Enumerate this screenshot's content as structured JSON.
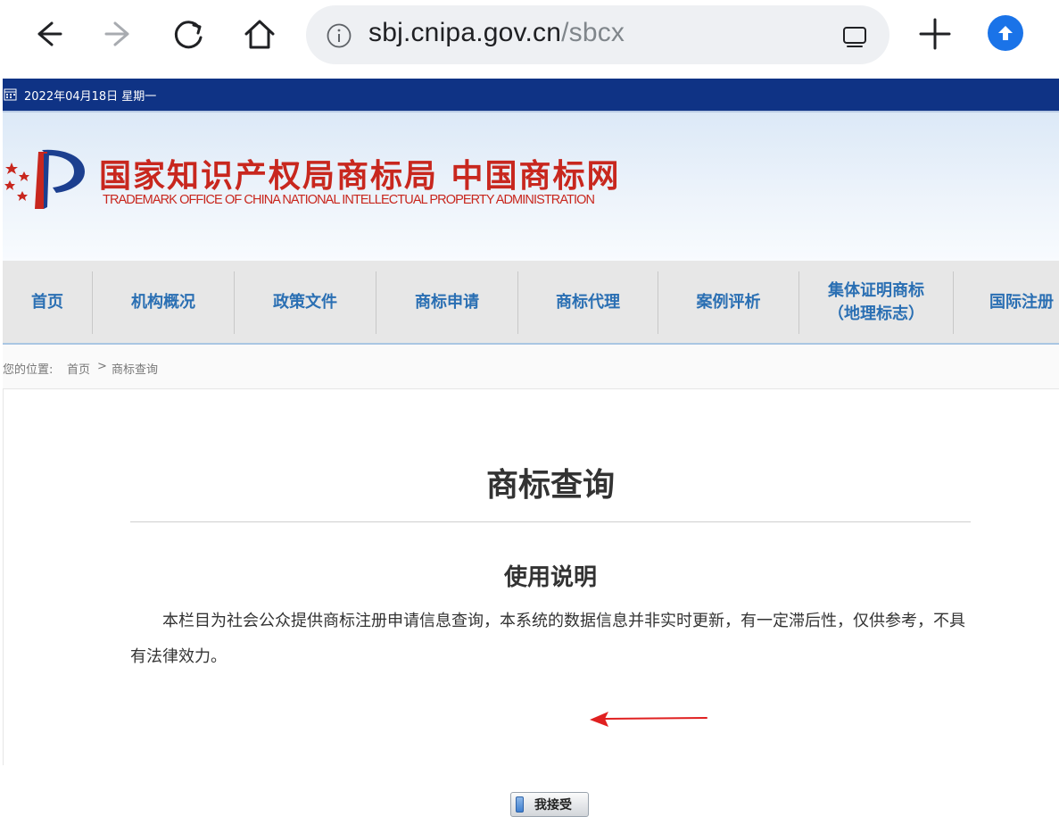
{
  "browser": {
    "url_host": "sbj.cnipa.gov.cn",
    "url_path": "/sbcx",
    "icons": [
      "back-icon",
      "forward-icon",
      "reload-icon",
      "home-icon",
      "info-icon",
      "tab-switcher-icon",
      "new-tab-icon",
      "update-icon"
    ],
    "accent_color": "#1a73e8"
  },
  "site": {
    "date": "2022年04月18日 星期一",
    "title": "国家知识产权局商标局 中国商标网",
    "subtitle": "TRADEMARK OFFICE OF CHINA NATIONAL INTELLECTUAL PROPERTY ADMINISTRATION",
    "brand_color": "#c8271e",
    "header_color": "#0f3385",
    "nav": [
      {
        "label": "首页"
      },
      {
        "label": "机构概况"
      },
      {
        "label": "政策文件"
      },
      {
        "label": "商标申请"
      },
      {
        "label": "商标代理"
      },
      {
        "label": "案例评析"
      },
      {
        "label_line1": "集体证明商标",
        "label_line2": "（地理标志）"
      },
      {
        "label": "国际注册"
      }
    ],
    "breadcrumb": {
      "prefix": "您的位置:",
      "home": "首页",
      "sep": ">",
      "current": "商标查询"
    }
  },
  "main": {
    "title": "商标查询",
    "section_title": "使用说明",
    "description": "本栏目为社会公众提供商标注册申请信息查询，本系统的数据信息并非实时更新，有一定滞后性，仅供参考，不具有法律效力。",
    "accept_label": "我接受"
  }
}
